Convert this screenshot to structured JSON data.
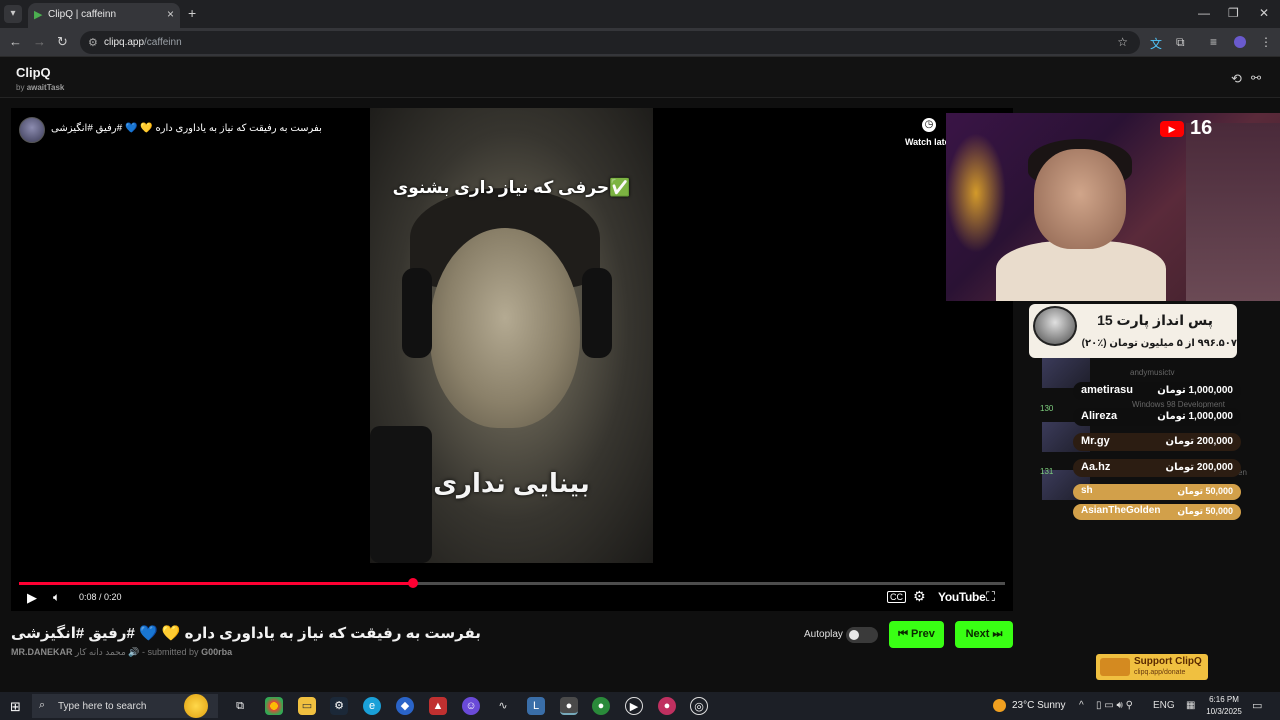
{
  "browser": {
    "tab_title": "ClipQ | caffeinn",
    "url_host": "clipq.app",
    "url_path": "/caffeinn"
  },
  "app": {
    "title": "ClipQ",
    "by_prefix": "by",
    "by_name": "awaitTask"
  },
  "player": {
    "overlay_title": "بفرست به رفیقت که نیاز به یاداوری داره 💛 💙 #رفیق #انگیزشی",
    "watch_later": "Watch late",
    "video_top_text": "✅حرفی که نیاز داری بشنوی",
    "video_caption": "بینایی نداری",
    "time": "0:08 / 0:20",
    "progress_fraction": 0.4,
    "cc_label": "CC",
    "youtube_label": "YouTube"
  },
  "clip": {
    "title": "بفرست به رفیقت که نیاز به یاداوری داره 💛 💙 #رفیق #انگیزشی",
    "channel": "MR.DANEKAR",
    "channel_extra": "محمد دانه کار 🔊",
    "submitted_prefix": "- submitted by",
    "submitter": "G00rba"
  },
  "controls": {
    "autoplay_label": "Autoplay",
    "autoplay_on": false,
    "prev_label": "Prev",
    "next_label": "Next"
  },
  "stream": {
    "viewer_count": "16",
    "savings_title": "پس انداز پارت 15",
    "savings_sub": "۹۹۶.۵۰۷ از ۵ میلیون تومان (٪۲۰)",
    "chat_numbers": [
      "130",
      "131"
    ],
    "chat_ghost": [
      "andymusictv",
      "Windows 98 Development",
      "en"
    ],
    "donations": [
      {
        "name": "ametirasu",
        "amount": "1,000,000 تومان"
      },
      {
        "name": "Alireza",
        "amount": "1,000,000 تومان"
      },
      {
        "name": "Mr.gy",
        "amount": "200,000 تومان"
      },
      {
        "name": "Aa.hz",
        "amount": "200,000 تومان"
      },
      {
        "name": "sh",
        "amount": "50,000 تومان"
      },
      {
        "name": "AsianTheGolden",
        "amount": "50,000 تومان"
      }
    ],
    "support_title": "Support ClipQ",
    "support_url": "clipq.app/donate"
  },
  "taskbar": {
    "search_placeholder": "Type here to search",
    "weather": "23°C  Sunny",
    "lang": "ENG",
    "time": "6:16 PM",
    "date": "10/3/2025"
  },
  "colors": {
    "accent_green": "#39ff14",
    "progress_red": "#ff0033",
    "youtube_red": "#ff0000"
  }
}
